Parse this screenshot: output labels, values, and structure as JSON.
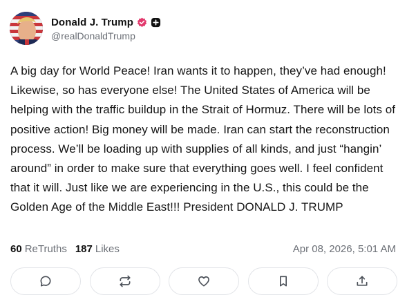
{
  "author": {
    "display_name": "Donald J. Trump",
    "handle": "@realDonaldTrump",
    "verified_icon": "verified-badge-icon",
    "plus_icon": "plus-badge-icon",
    "badge_color": "#e23a6d"
  },
  "post": {
    "text": "A big day for World Peace! Iran wants it to happen, they’ve had enough! Likewise, so has everyone else! The United States of America will be helping with the traffic buildup in the Strait of Hormuz. There will be lots of positive action! Big money will be made. Iran can start the reconstruction process. We’ll be loading up with supplies of all kinds, and just “hangin’ around” in order to make sure that everything goes well. I feel confident that it will. Just like we are experiencing in the U.S., this could be the Golden Age of the Middle East!!! President DONALD J. TRUMP",
    "retruths_count": "60",
    "retruths_label": "ReTruths",
    "likes_count": "187",
    "likes_label": "Likes",
    "timestamp": "Apr 08, 2026, 5:01 AM"
  },
  "actions": [
    {
      "icon": "reply-icon"
    },
    {
      "icon": "retruth-icon"
    },
    {
      "icon": "like-heart-icon"
    },
    {
      "icon": "bookmark-icon"
    },
    {
      "icon": "share-icon"
    }
  ]
}
